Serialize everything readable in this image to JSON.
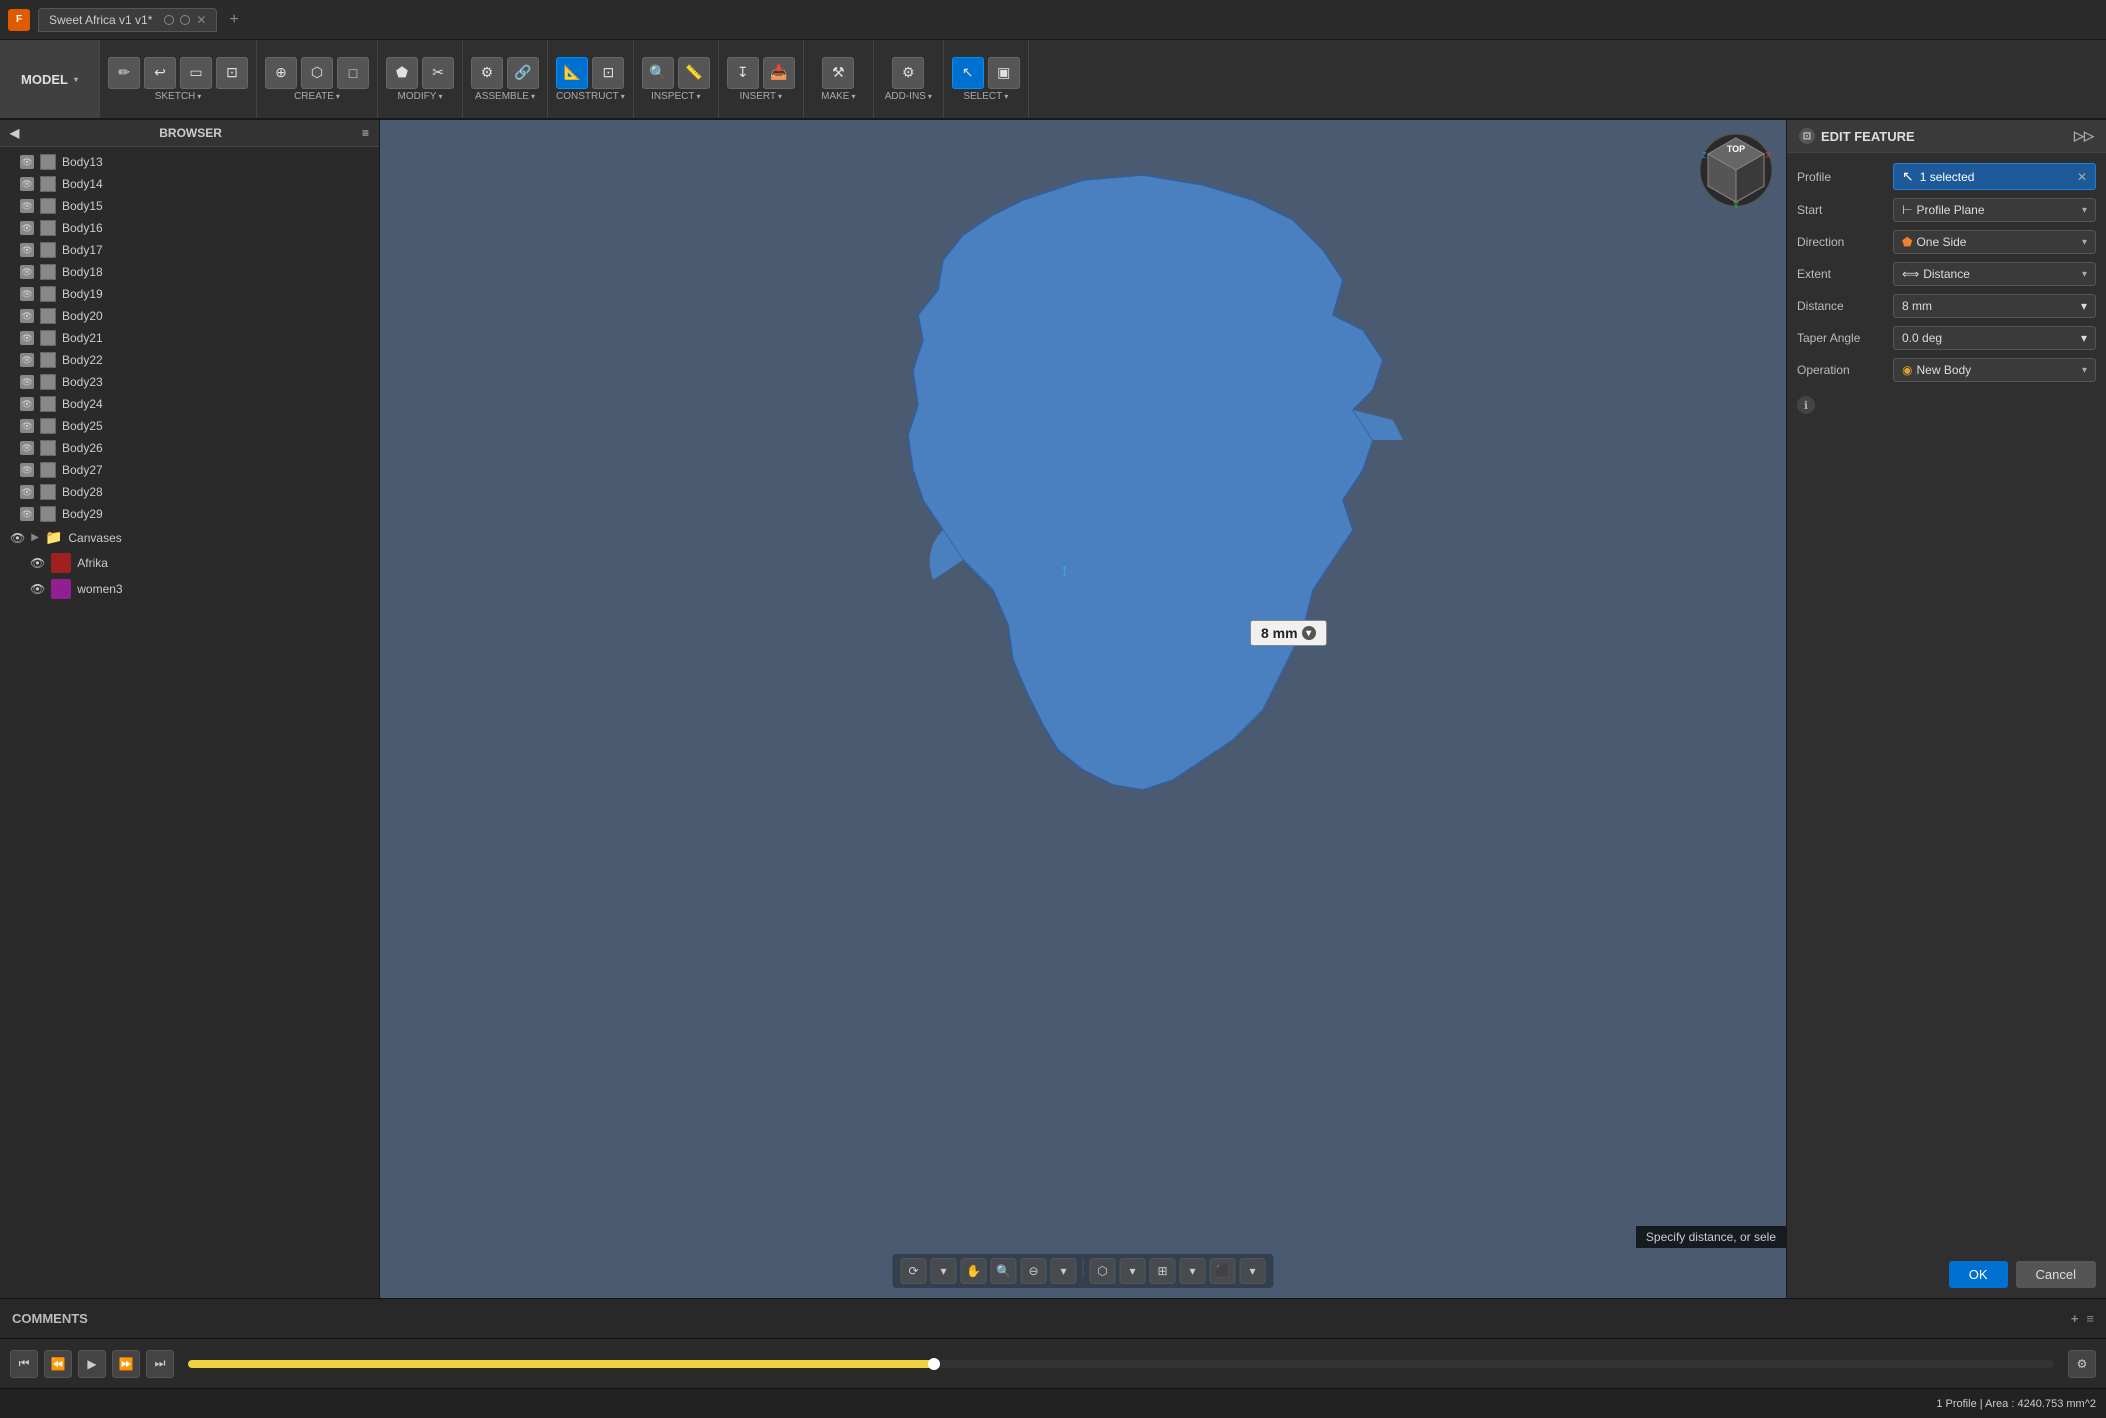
{
  "titlebar": {
    "app_name": "Sweet Africa v1 v1*",
    "circle1": "⊙",
    "circle2": "⊙",
    "tab_label": "Sweet Africa v1 v1*"
  },
  "toolbar": {
    "model_label": "MODEL",
    "groups": [
      {
        "id": "sketch",
        "label": "SKETCH",
        "icons": [
          "✏",
          "↩",
          "▭",
          "--"
        ]
      },
      {
        "id": "create",
        "label": "CREATE",
        "icons": [
          "⊕",
          "⬡",
          "□"
        ]
      },
      {
        "id": "modify",
        "label": "MODIFY",
        "icons": [
          "⬟",
          "✂",
          "∿"
        ]
      },
      {
        "id": "assemble",
        "label": "ASSEMBLE",
        "icons": [
          "⚙",
          "🔗",
          "⚯"
        ]
      },
      {
        "id": "construct",
        "label": "CONSTRUCT",
        "icons": [
          "📐",
          "◫",
          "⟂"
        ]
      },
      {
        "id": "inspect",
        "label": "INSPECT",
        "icons": [
          "🔍",
          "📏",
          "∡"
        ]
      },
      {
        "id": "insert",
        "label": "INSERT",
        "icons": [
          "↧",
          "📥"
        ]
      },
      {
        "id": "make",
        "label": "MAKE",
        "icons": [
          "⚒",
          "🖨"
        ]
      },
      {
        "id": "add_ins",
        "label": "ADD-INS",
        "icons": [
          "⚙",
          "➕"
        ]
      },
      {
        "id": "select",
        "label": "SELECT",
        "icons": [
          "↖",
          "▣"
        ]
      }
    ]
  },
  "browser": {
    "title": "BROWSER",
    "bodies": [
      "Body13",
      "Body14",
      "Body15",
      "Body16",
      "Body17",
      "Body18",
      "Body19",
      "Body20",
      "Body21",
      "Body22",
      "Body23",
      "Body24",
      "Body25",
      "Body26",
      "Body27",
      "Body28",
      "Body29"
    ],
    "folders": [
      "Canvases"
    ],
    "canvases": [
      "Afrika",
      "women3"
    ]
  },
  "viewport": {
    "orientation": "top",
    "distance_badge": "8 mm",
    "africa_area": "4240.753 mm^2",
    "profile_count": "1"
  },
  "edit_feature": {
    "title": "EDIT FEATURE",
    "fields": [
      {
        "label": "Profile",
        "type": "chip",
        "value": "1 selected"
      },
      {
        "label": "Start",
        "type": "dropdown",
        "value": "Profile Plane"
      },
      {
        "label": "Direction",
        "type": "dropdown",
        "value": "One Side"
      },
      {
        "label": "Extent",
        "type": "dropdown",
        "value": "Distance"
      },
      {
        "label": "Distance",
        "type": "input",
        "value": "8 mm"
      },
      {
        "label": "Taper Angle",
        "type": "input",
        "value": "0.0 deg"
      },
      {
        "label": "Operation",
        "type": "dropdown",
        "value": "New Body"
      }
    ],
    "ok_label": "OK",
    "cancel_label": "Cancel"
  },
  "statusbar": {
    "left": "",
    "right": "1 Profile | Area : 4240.753 mm^2",
    "hint": "Specify distance, or sele"
  },
  "comments": {
    "label": "COMMENTS"
  },
  "playback": {
    "icons": [
      "⏮",
      "⏪",
      "▶",
      "⏩",
      "⏭"
    ]
  }
}
